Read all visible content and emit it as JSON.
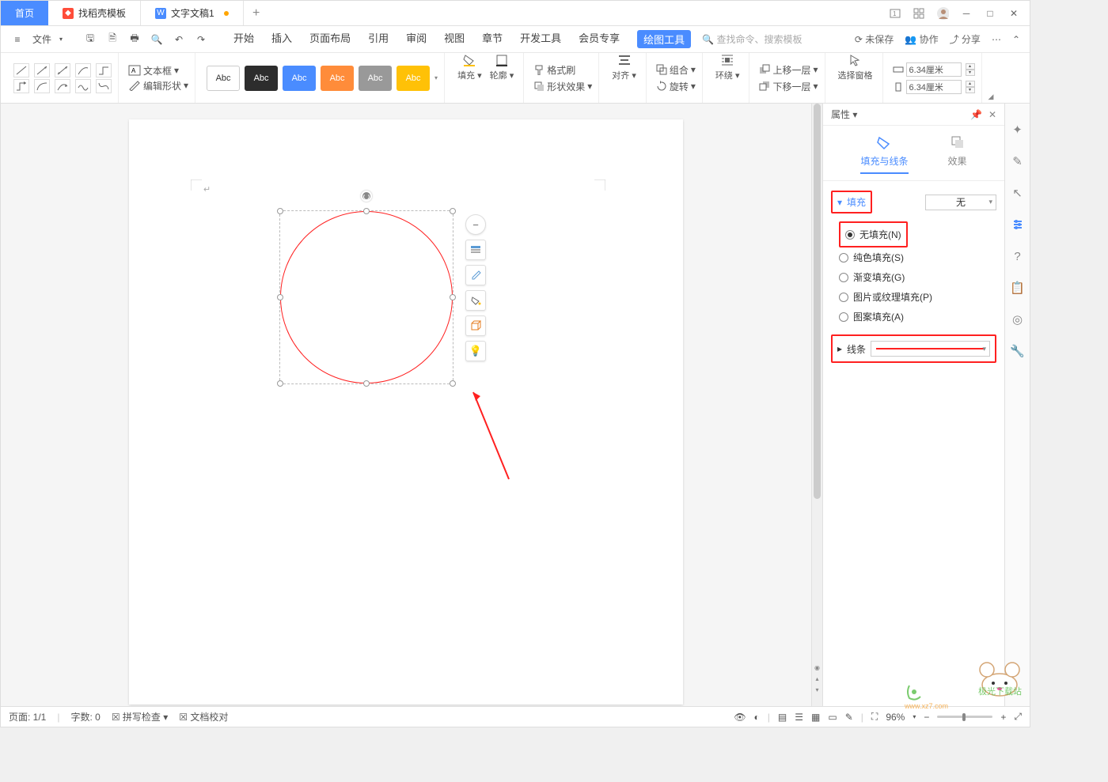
{
  "tabs": {
    "home": "首页",
    "template_tab": "找稻壳模板",
    "doc_tab": "文字文稿1"
  },
  "title_right": {
    "unsaved": "未保存",
    "collab": "协作",
    "share": "分享"
  },
  "file_menu": "文件",
  "menu": {
    "start": "开始",
    "insert": "插入",
    "page_layout": "页面布局",
    "references": "引用",
    "review": "审阅",
    "view": "视图",
    "chapter": "章节",
    "dev_tools": "开发工具",
    "member": "会员专享",
    "draw_tools": "绘图工具"
  },
  "search_placeholder": "查找命令、搜索模板",
  "ribbon": {
    "text_box": "文本框",
    "edit_shape": "编辑形状",
    "style_label": "Abc",
    "fill": "填充",
    "outline": "轮廓",
    "format_painter": "格式刷",
    "shape_effects": "形状效果",
    "align": "对齐",
    "group": "组合",
    "rotate": "旋转",
    "wrap": "环绕",
    "bring_forward": "上移一层",
    "send_backward": "下移一层",
    "selection_pane": "选择窗格",
    "width": "6.34厘米",
    "height": "6.34厘米"
  },
  "prop": {
    "title": "属性",
    "tab_fill_line": "填充与线条",
    "tab_effects": "效果",
    "section_fill": "填充",
    "fill_none": "无",
    "radio_no_fill": "无填充(N)",
    "radio_solid": "纯色填充(S)",
    "radio_gradient": "渐变填充(G)",
    "radio_picture": "图片或纹理填充(P)",
    "radio_pattern": "图案填充(A)",
    "section_line": "线条"
  },
  "status": {
    "page": "页面: 1/1",
    "words": "字数: 0",
    "spell": "拼写检查",
    "proof": "文档校对",
    "zoom": "96%"
  },
  "watermark": "极光下载站"
}
